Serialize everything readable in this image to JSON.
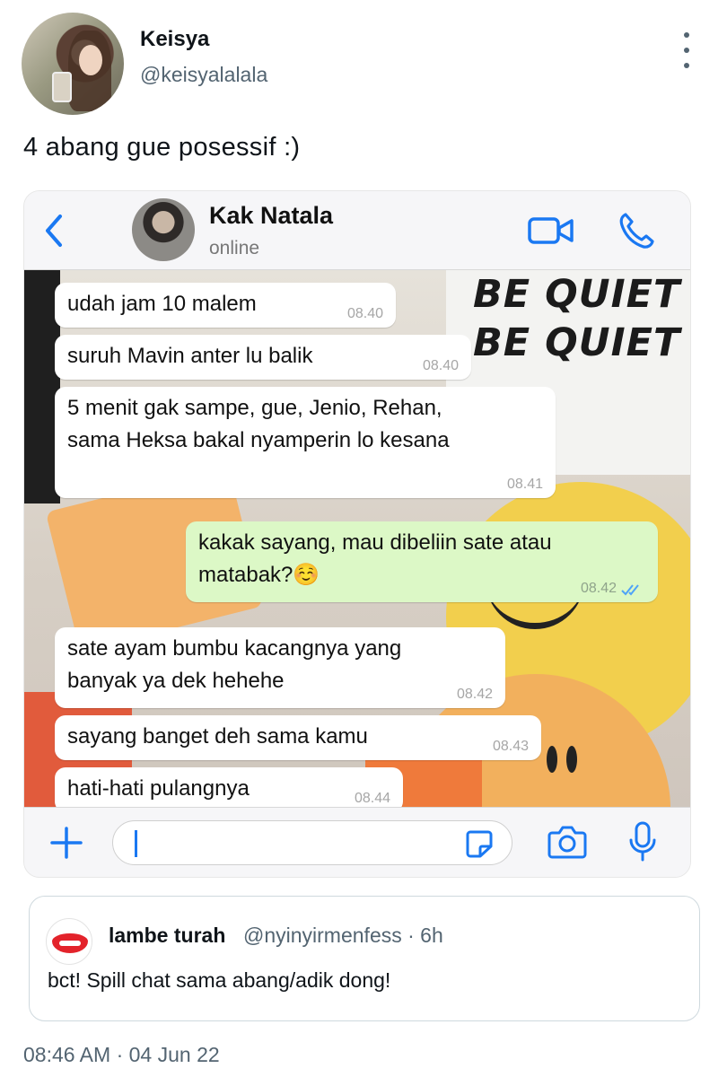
{
  "author": {
    "display_name": "Keisya",
    "handle": "@keisyalalala",
    "avatar_icon": "profile-photo"
  },
  "tweet": {
    "text": "4 abang gue posessif :)",
    "timestamp": "08:46 AM · 04 Jun 22"
  },
  "chat_screenshot": {
    "contact_name": "Kak Natala",
    "contact_status": "online",
    "background_sign_lines": [
      "BE QUIET",
      "BE QUIET"
    ],
    "messages": [
      {
        "direction": "in",
        "lines": [
          "udah jam 10 malem"
        ],
        "time": "08.40"
      },
      {
        "direction": "in",
        "lines": [
          "suruh Mavin anter lu balik"
        ],
        "time": "08.40"
      },
      {
        "direction": "in",
        "lines": [
          "5 menit gak sampe, gue, Jenio, Rehan,",
          "sama Heksa bakal nyamperin lo kesana"
        ],
        "time": "08.41"
      },
      {
        "direction": "out",
        "lines": [
          "kakak sayang, mau dibeliin sate atau",
          "matabak?☺️"
        ],
        "time": "08.42",
        "read_ticks": "double-check-blue"
      },
      {
        "direction": "in",
        "lines": [
          "sate ayam bumbu kacangnya yang",
          "banyak ya dek hehehe"
        ],
        "time": "08.42"
      },
      {
        "direction": "in",
        "lines": [
          "sayang banget deh sama kamu"
        ],
        "time": "08.43"
      },
      {
        "direction": "in",
        "lines": [
          "hati-hati pulangnya"
        ],
        "time": "08.44"
      }
    ],
    "accent_color": "#1a78f2",
    "incoming_bubble_color": "#ffffff",
    "outgoing_bubble_color": "#dcf8c6"
  },
  "quoted_tweet": {
    "display_name": "lambe turah",
    "meta": "@nyinyirmenfess · 6h",
    "text": "bct! Spill chat sama abang/adik dong!",
    "avatar_icon": "lips-logo"
  }
}
